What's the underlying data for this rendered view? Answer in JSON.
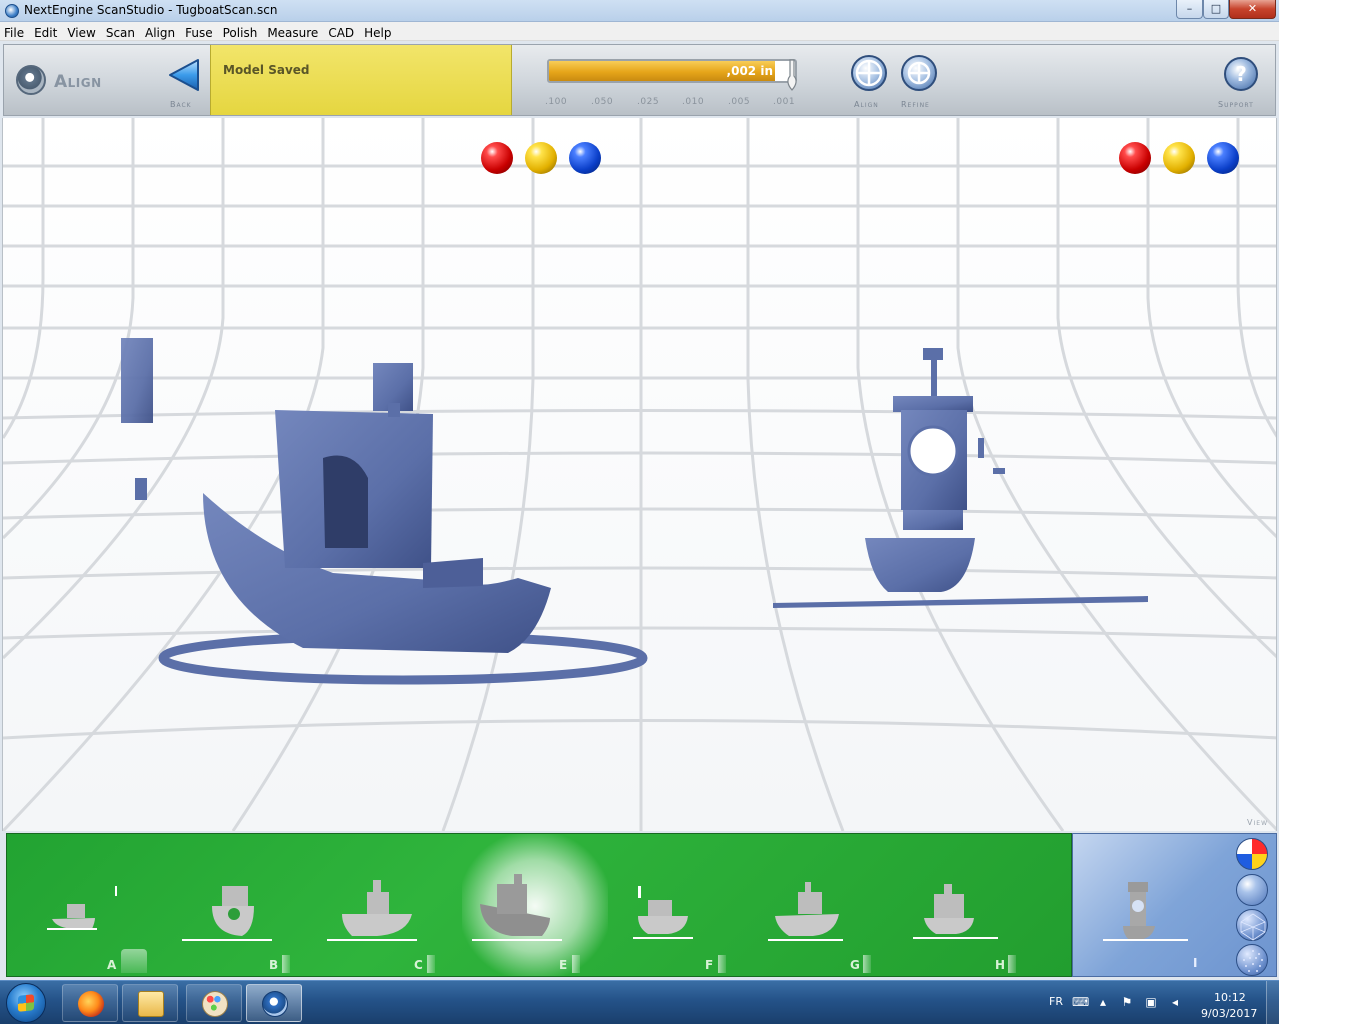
{
  "window": {
    "title": "NextEngine ScanStudio - TugboatScan.scn",
    "min_glyph": "–",
    "max_glyph": "□",
    "close_glyph": "✕"
  },
  "menu": [
    "File",
    "Edit",
    "View",
    "Scan",
    "Align",
    "Fuse",
    "Polish",
    "Measure",
    "CAD",
    "Help"
  ],
  "toolbar": {
    "mode_title": "Align",
    "back_label": "Back",
    "status_text": "Model Saved",
    "tolerance": {
      "value_text": ",002 in",
      "fill_fraction": 0.92,
      "ticks": [
        ".100",
        ".050",
        ".025",
        ".010",
        ".005",
        ".001"
      ]
    },
    "align_label": "Align",
    "refine_label": "Refine",
    "support_label": "Support",
    "support_glyph": "?"
  },
  "viewport": {
    "view_label": "View",
    "mesh_color": "#5b6fa8",
    "ball_colors": [
      "red",
      "yellow",
      "blue"
    ]
  },
  "thumbnails": {
    "items": [
      {
        "letter": "A",
        "selected": false
      },
      {
        "letter": "B",
        "selected": false
      },
      {
        "letter": "C",
        "selected": false
      },
      {
        "letter": "E",
        "selected": true
      },
      {
        "letter": "F",
        "selected": false
      },
      {
        "letter": "G",
        "selected": false
      },
      {
        "letter": "H",
        "selected": false
      }
    ],
    "preview_letter": "I"
  },
  "taskbar": {
    "apps": [
      "firefox-icon",
      "file-explorer-icon",
      "paint-icon",
      "scanstudio-icon"
    ],
    "language": "FR",
    "time": "10:12",
    "date": "9/03/2017"
  }
}
